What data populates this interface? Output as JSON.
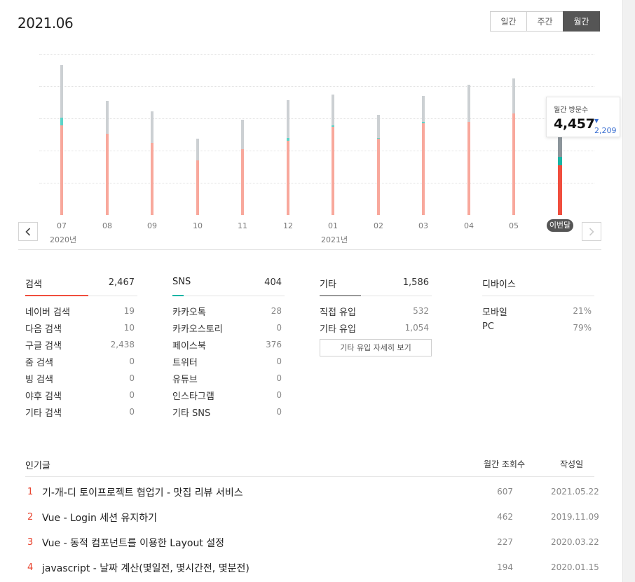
{
  "header": {
    "period": "2021.06",
    "tabs": [
      {
        "label": "일간",
        "active": false
      },
      {
        "label": "주간",
        "active": false
      },
      {
        "label": "월간",
        "active": true
      }
    ]
  },
  "colors": {
    "search": "#f8a89c",
    "search_current": "#f04e3e",
    "sns": "#5cd4c8",
    "sns_current": "#18b5a5",
    "other": "#ccd0d3",
    "other_current": "#8c959b"
  },
  "chart_data": {
    "type": "bar",
    "stacked": true,
    "categories": [
      "07",
      "08",
      "09",
      "10",
      "11",
      "12",
      "01",
      "02",
      "03",
      "04",
      "05",
      "이번달"
    ],
    "year_labels": [
      {
        "label": "2020년",
        "at": "07"
      },
      {
        "label": "2021년",
        "at": "01"
      }
    ],
    "series": [
      {
        "name": "검색",
        "values": [
          4440,
          4010,
          3550,
          2700,
          3250,
          3680,
          4370,
          3790,
          4530,
          4590,
          5010,
          2467
        ]
      },
      {
        "name": "SNS",
        "values": [
          380,
          10,
          10,
          10,
          10,
          130,
          60,
          30,
          60,
          10,
          10,
          404
        ]
      },
      {
        "name": "기타",
        "values": [
          2590,
          1620,
          1560,
          1080,
          1460,
          1860,
          1510,
          1130,
          1300,
          1830,
          1720,
          1586
        ]
      }
    ],
    "ylim": [
      0,
      9000
    ],
    "grid": true,
    "highlight_index": 11,
    "tooltip": {
      "label": "월간 방문수",
      "value": "4,457",
      "delta": "2,209",
      "delta_direction": "down"
    }
  },
  "stats": [
    {
      "title": "검색",
      "total": "2,467",
      "accent": "#f04e3e",
      "underline_fraction": 0.56,
      "rows": [
        {
          "label": "네이버 검색",
          "value": "19"
        },
        {
          "label": "다음 검색",
          "value": "10"
        },
        {
          "label": "구글 검색",
          "value": "2,438"
        },
        {
          "label": "줌 검색",
          "value": "0"
        },
        {
          "label": "빙 검색",
          "value": "0"
        },
        {
          "label": "야후 검색",
          "value": "0"
        },
        {
          "label": "기타 검색",
          "value": "0"
        }
      ]
    },
    {
      "title": "SNS",
      "total": "404",
      "accent": "#18b5a5",
      "underline_fraction": 0.1,
      "rows": [
        {
          "label": "카카오톡",
          "value": "28"
        },
        {
          "label": "카카오스토리",
          "value": "0"
        },
        {
          "label": "페이스북",
          "value": "376"
        },
        {
          "label": "트위터",
          "value": "0"
        },
        {
          "label": "유튜브",
          "value": "0"
        },
        {
          "label": "인스타그램",
          "value": "0"
        },
        {
          "label": "기타 SNS",
          "value": "0"
        }
      ]
    },
    {
      "title": "기타",
      "total": "1,586",
      "accent": "#999999",
      "underline_fraction": 0.37,
      "rows": [
        {
          "label": "직접 유입",
          "value": "532"
        },
        {
          "label": "기타 유입",
          "value": "1,054"
        }
      ],
      "button": "기타 유입 자세히 보기"
    },
    {
      "title": "디바이스",
      "total": "",
      "accent": "",
      "underline_fraction": 0,
      "rows": [
        {
          "label": "모바일",
          "value": "21%"
        },
        {
          "label": "PC",
          "value": "79%"
        }
      ]
    }
  ],
  "popular": {
    "heading": "인기글",
    "col_views": "월간 조회수",
    "col_date": "작성일",
    "posts": [
      {
        "rank": "1",
        "title": "기-개-디 토이프로젝트 협업기 - 맛집 리뷰 서비스",
        "views": "607",
        "date": "2021.05.22"
      },
      {
        "rank": "2",
        "title": "Vue - Login 세션 유지하기",
        "views": "462",
        "date": "2019.11.09"
      },
      {
        "rank": "3",
        "title": "Vue - 동적 컴포넌트를 이용한 Layout 설정",
        "views": "227",
        "date": "2020.03.22"
      },
      {
        "rank": "4",
        "title": "javascript - 날짜 계산(몇일전, 몇시간전, 몇분전)",
        "views": "194",
        "date": "2020.01.15"
      }
    ]
  }
}
